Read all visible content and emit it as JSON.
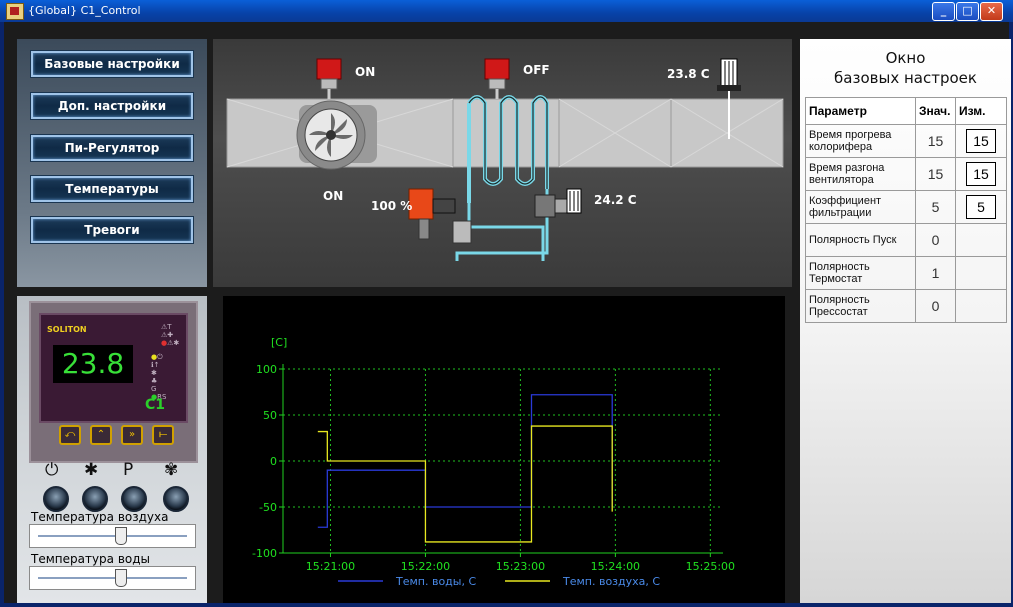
{
  "window": {
    "title": "{Global} C1_Control"
  },
  "nav": {
    "buttons": [
      "Базовые настройки",
      "Доп. настройки",
      "Пи-Регулятор",
      "Температуры",
      "Тревоги"
    ]
  },
  "device": {
    "brand": "SOLITON",
    "display_value": "23.8",
    "model": "C1"
  },
  "controls": {
    "air_temp_label": "Температура воздуха",
    "water_temp_label": "Температура воды",
    "air_slider_level": 0.55,
    "water_slider_level": 0.55
  },
  "diagram": {
    "fan_valve_status": "ON",
    "heater_valve_status": "OFF",
    "fan_status": "ON",
    "air_temp": "23.8 C",
    "valve_percent": "100 %",
    "water_temp": "24.2 C"
  },
  "settings": {
    "title_line1": "Окно",
    "title_line2": "базовых настроек",
    "headers": [
      "Параметр",
      "Знач.",
      "Изм."
    ],
    "rows": [
      {
        "param": "Время прогрева колорифера",
        "value": "15",
        "edit": "15"
      },
      {
        "param": "Время разгона вентилятора",
        "value": "15",
        "edit": "15"
      },
      {
        "param": "Коэффициент фильтрации",
        "value": "5",
        "edit": "5"
      },
      {
        "param": "Полярность Пуск",
        "value": "0",
        "edit": ""
      },
      {
        "param": "Полярность Термостат",
        "value": "1",
        "edit": ""
      },
      {
        "param": "Полярность Прессостат",
        "value": "0",
        "edit": ""
      }
    ]
  },
  "chart_data": {
    "type": "line",
    "ylabel": "[C]",
    "ylim": [
      -100,
      100
    ],
    "yticks": [
      "100",
      "50",
      "0",
      "-50",
      "-100"
    ],
    "ytick_values": [
      100,
      50,
      0,
      -50,
      -100
    ],
    "xticks": [
      "15:21:00",
      "15:22:00",
      "15:23:00",
      "15:24:00",
      "15:25:00"
    ],
    "grid": true,
    "legend_placement": "bottom",
    "series": [
      {
        "name": "Темп. воды, С",
        "color": "#2a3ad8",
        "x": [
          "15:20:52",
          "15:20:58",
          "15:20:58",
          "15:22:00",
          "15:22:00",
          "15:23:07",
          "15:23:07",
          "15:23:58",
          "15:23:58"
        ],
        "y": [
          -72,
          -72,
          -10,
          -10,
          -50,
          -50,
          72,
          72,
          -50
        ]
      },
      {
        "name": "Темп. воздуха, С",
        "color": "#e8e820",
        "x": [
          "15:20:52",
          "15:20:58",
          "15:20:58",
          "15:22:00",
          "15:22:00",
          "15:23:07",
          "15:23:07",
          "15:23:58",
          "15:23:58"
        ],
        "y": [
          32,
          32,
          0,
          0,
          -88,
          -88,
          38,
          38,
          -55
        ]
      }
    ]
  }
}
